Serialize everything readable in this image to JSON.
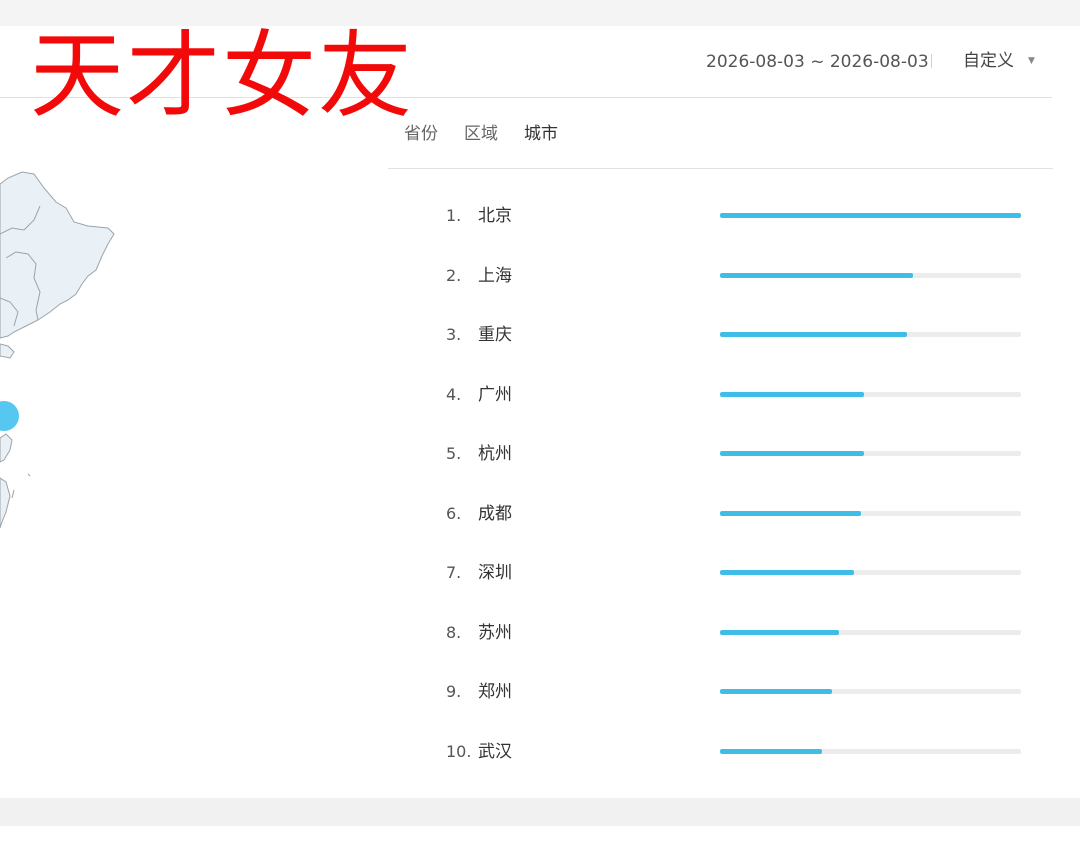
{
  "watermark": {
    "text": "天才女友",
    "color": "#f20a0a"
  },
  "header": {
    "date_range": "2026-08-03 ~ 2026-08-03",
    "range_mode": "自定义",
    "caret_icon": "caret-down-icon"
  },
  "tabs": [
    {
      "label": "省份",
      "active": false
    },
    {
      "label": "区域",
      "active": false
    },
    {
      "label": "城市",
      "active": true
    }
  ],
  "colors": {
    "bar_fill": "#3ebde6",
    "bar_track": "#ececec",
    "map_fill": "#e9f1f6",
    "map_stroke": "#9aa4ab",
    "map_marker": "#4cc4ef"
  },
  "ranking": [
    {
      "rank": "1.",
      "city": "北京",
      "share": 1.0
    },
    {
      "rank": "2.",
      "city": "上海",
      "share": 0.64
    },
    {
      "rank": "3.",
      "city": "重庆",
      "share": 0.62
    },
    {
      "rank": "4.",
      "city": "广州",
      "share": 0.48
    },
    {
      "rank": "5.",
      "city": "杭州",
      "share": 0.477
    },
    {
      "rank": "6.",
      "city": "成都",
      "share": 0.467
    },
    {
      "rank": "7.",
      "city": "深圳",
      "share": 0.445
    },
    {
      "rank": "8.",
      "city": "苏州",
      "share": 0.397
    },
    {
      "rank": "9.",
      "city": "郑州",
      "share": 0.372
    },
    {
      "rank": "10.",
      "city": "武汉",
      "share": 0.338
    }
  ]
}
